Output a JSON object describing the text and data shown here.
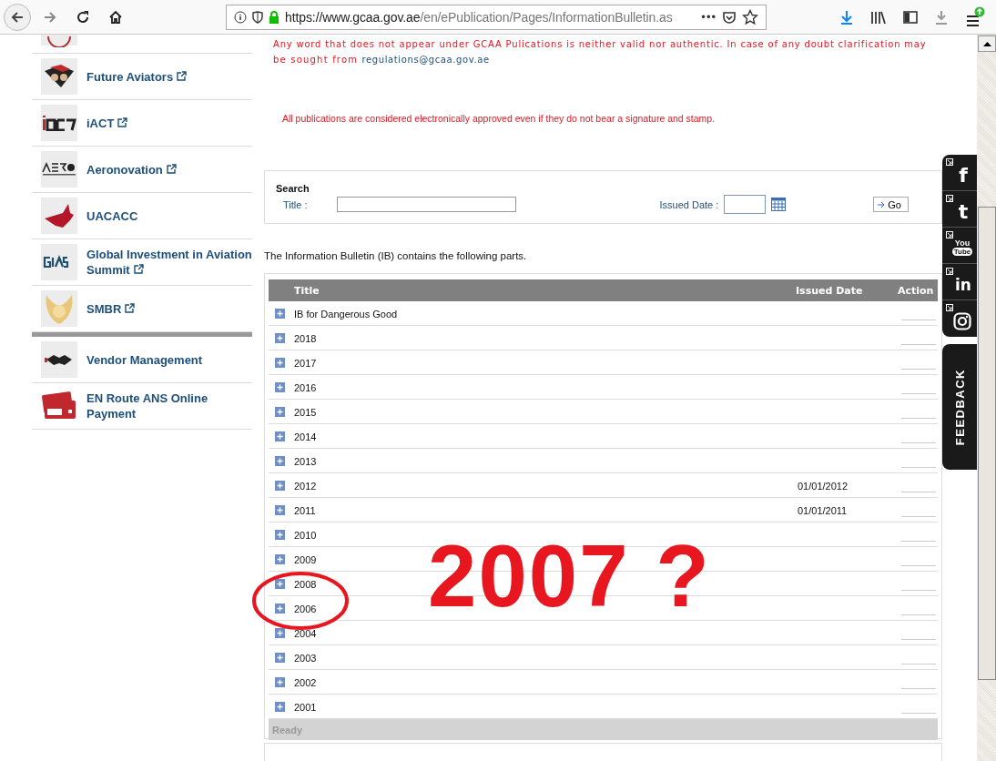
{
  "browser": {
    "url_host": "https://www.gcaa.gov.ae",
    "url_path": "/en/ePublication/Pages/InformationBulletin.as",
    "more": "•••"
  },
  "sidebar": {
    "groups": [
      {
        "items": [
          {
            "label": "Future Aviators",
            "external": true
          },
          {
            "label": "iACT",
            "external": true
          },
          {
            "label": "Aeronovation",
            "external": true
          },
          {
            "label": "UACACC",
            "external": false
          },
          {
            "label": "Global Investment in Aviation Summit",
            "external": true
          },
          {
            "label": "SMBR",
            "external": true
          }
        ]
      },
      {
        "items": [
          {
            "label": "Vendor Management",
            "external": false
          },
          {
            "label": "EN Route ANS Online Payment",
            "external": false
          }
        ]
      }
    ]
  },
  "notice": {
    "line_1": "Any word that does not appear under GCAA Pulications is neither  valid nor authentic. In case of any doubt clarification may",
    "line_2": "be sought from",
    "email": "regulations@gcaa.gov.ae",
    "approval": "All publications are considered electronically approved even if they do not bear a signature and stamp."
  },
  "search": {
    "heading": "Search",
    "title_label": "Title :",
    "date_label": "Issued Date :",
    "go": "Go"
  },
  "intro": "The Information Bulletin (IB) contains the following parts.",
  "table": {
    "columns": [
      "Title",
      "Issued Date",
      "Action"
    ],
    "rows": [
      {
        "title": "IB for Dangerous Good",
        "expanded": false
      },
      {
        "title": "2018",
        "expanded": false
      },
      {
        "title": "2017",
        "expanded": false
      },
      {
        "title": "2016",
        "expanded": false
      },
      {
        "title": "2015",
        "expanded": false
      },
      {
        "title": "2014",
        "expanded": false
      },
      {
        "title": "2013",
        "expanded": false
      },
      {
        "title": "2012",
        "issued_date": "01/01/2012",
        "expanded": false
      },
      {
        "title": "2011",
        "issued_date": "01/01/2011",
        "expanded": false
      },
      {
        "title": "2010",
        "expanded": false
      },
      {
        "title": "2009",
        "expanded": false
      },
      {
        "title": "2008",
        "expanded": false
      },
      {
        "title": "2006",
        "expanded": false
      },
      {
        "title": "2004",
        "expanded": false
      },
      {
        "title": "2003",
        "expanded": false
      },
      {
        "title": "2002",
        "expanded": false
      },
      {
        "title": "2001",
        "expanded": false
      }
    ],
    "status": "Ready"
  },
  "annotation": {
    "text": "2007 ?"
  },
  "social": [
    {
      "kind": "facebook",
      "label": "f"
    },
    {
      "kind": "twitter",
      "label": "t"
    },
    {
      "kind": "youtube",
      "label": "You",
      "badge": "Tube"
    },
    {
      "kind": "linkedin",
      "label": "in"
    },
    {
      "kind": "instagram"
    }
  ],
  "feedback": "FEEDBACK"
}
